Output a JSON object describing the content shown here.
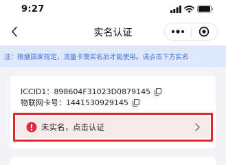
{
  "status_bar": {
    "time": "9:27",
    "icons": [
      "signal-icon",
      "wifi-icon",
      "battery-icon"
    ]
  },
  "nav": {
    "title": "实名认证",
    "back_icon": "chevron-left-icon",
    "more_icon": "more-dots-icon",
    "close_icon": "target-circle-icon"
  },
  "notice": {
    "text": "注：根据国家规定，流量卡需实名后才能使用。请点击下方实名"
  },
  "card": {
    "iccid_label": "ICCID1：",
    "iccid_value": "898604F31023D0879145",
    "iot_label": "物联网卡号：",
    "iot_value": "1441530929145"
  },
  "verify": {
    "text": "未实名，点击认证",
    "icon": "alert-circle-icon",
    "chevron": "chevron-right-icon"
  },
  "colors": {
    "notice_bg": "#dfe8fb",
    "notice_text": "#3d6ee0",
    "alert_red": "#d9303a",
    "highlight_border": "#e5232b",
    "verify_bg": "#f6e9ea"
  }
}
